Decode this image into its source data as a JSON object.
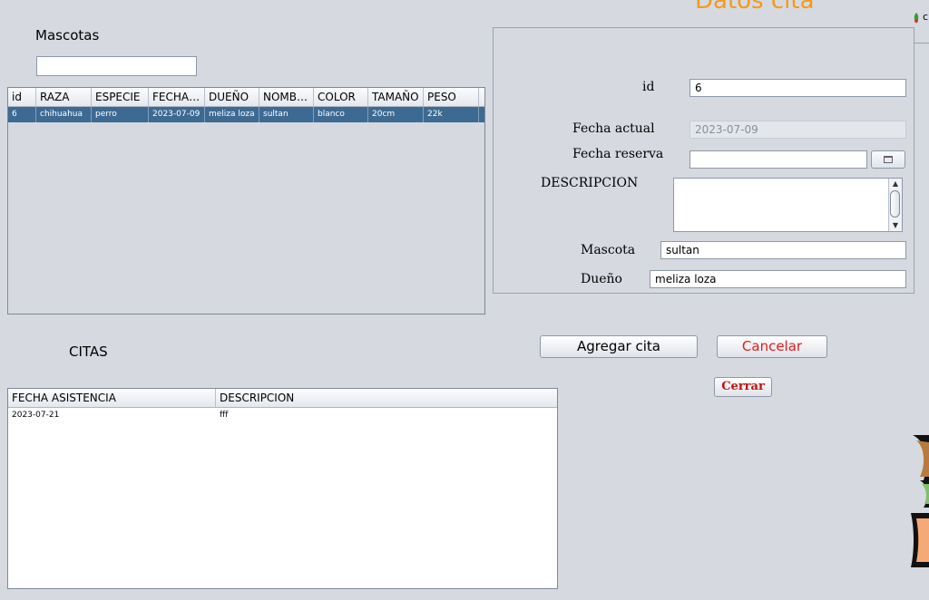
{
  "mascotas": {
    "label": "Mascotas",
    "search_value": "",
    "columns": [
      "id",
      "RAZA",
      "ESPECIE",
      "FECHA ...",
      "DUEÑO",
      "NOMBRE",
      "COLOR",
      "TAMAÑO",
      "PESO"
    ],
    "rows": [
      [
        "6",
        "chihuahua",
        "perro",
        "2023-07-09",
        "meliza loza",
        "sultan",
        "blanco",
        "20cm",
        "22k"
      ]
    ]
  },
  "citas": {
    "label": "CITAS",
    "columns": [
      "FECHA ASISTENCIA",
      "DESCRIPCION"
    ],
    "rows": [
      [
        "2023-07-21",
        "fff"
      ]
    ]
  },
  "form": {
    "title": "Datos cita",
    "id_label": "id",
    "id_value": "6",
    "fecha_actual_label": "Fecha actual",
    "fecha_actual_value": "2023-07-09",
    "fecha_reserva_label": "Fecha reserva",
    "fecha_reserva_value": "",
    "descripcion_label": "DESCRIPCION",
    "descripcion_value": "",
    "mascota_label": "Mascota",
    "mascota_value": "sultan",
    "dueno_label": "Dueño",
    "dueno_value": "meliza loza"
  },
  "buttons": {
    "agregar": "Agregar cita",
    "cancelar": "Cancelar",
    "cerrar": "Cerrar"
  },
  "edge": {
    "letter": "c"
  },
  "colors": {
    "title_orange": "#f39a1a",
    "selected_row": "#3d6a93",
    "cancel_red": "#e41b1b"
  }
}
